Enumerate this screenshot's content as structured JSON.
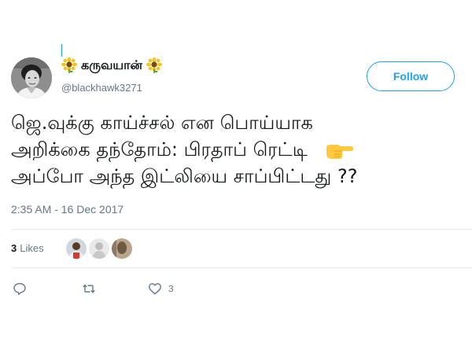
{
  "tweet": {
    "author": {
      "display_name": "கருவயான்",
      "handle": "@blackhawk3271"
    },
    "follow_label": "Follow",
    "text_lines": [
      "ஜெ.வுக்கு காய்ச்சல் என பொய்யாக",
      "அறிக்கை தந்தோம்: பிரதாப் ரெட்டி",
      "அப்போ அந்த இட்லியை சாப்பிட்டது ??"
    ],
    "timestamp": "2:35 AM - 16 Dec 2017",
    "likes": {
      "count": "3",
      "label": "Likes"
    },
    "actions": {
      "reply_count": "",
      "retweet_count": "",
      "like_count": "3"
    }
  },
  "icons": {
    "name_decoration": "sunflower-icon",
    "text_emoji": "backhand-pointing-right-icon",
    "reply": "reply-icon",
    "retweet": "retweet-icon",
    "like": "heart-icon"
  },
  "colors": {
    "accent": "#1da1f2",
    "secondary_text": "#657786",
    "primary_text": "#14171a",
    "divider": "#e6ecf0"
  }
}
